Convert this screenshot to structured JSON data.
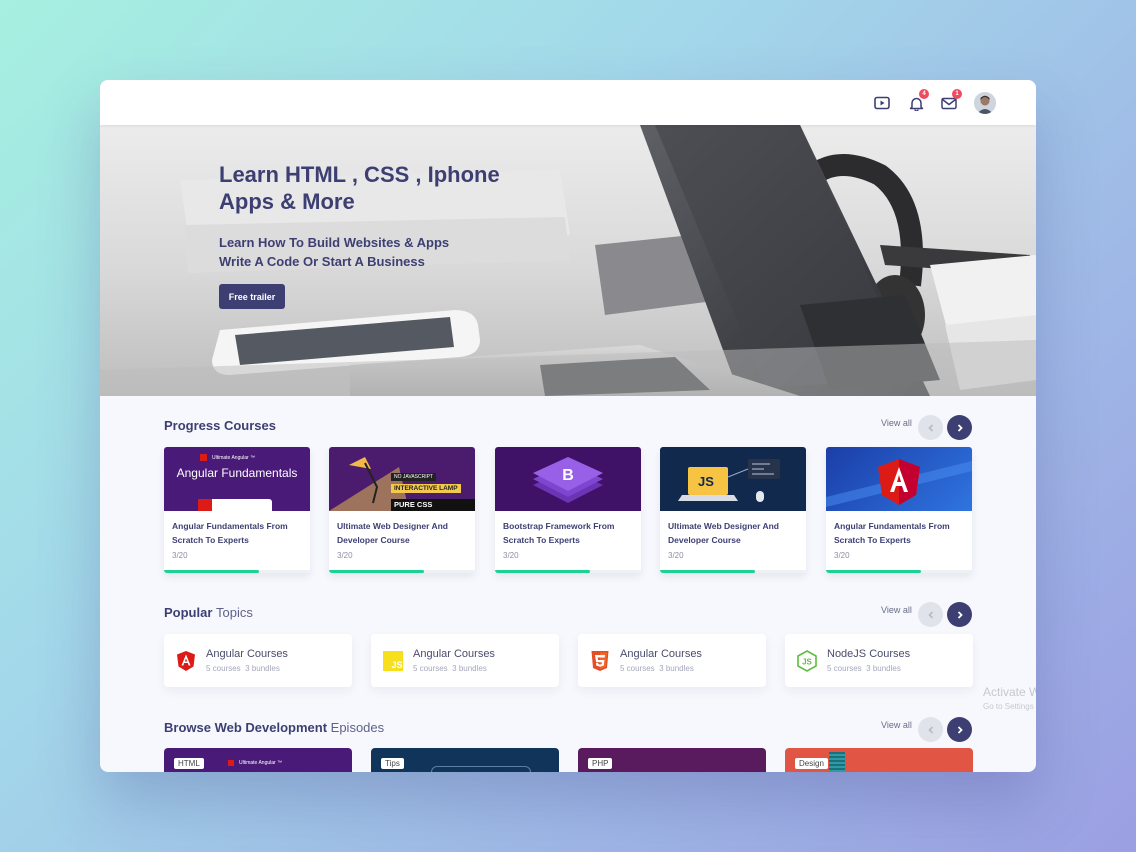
{
  "topbar": {
    "icons": [
      "video-icon",
      "bell-icon",
      "mail-icon"
    ],
    "notifications_count": "4",
    "messages_count": "1"
  },
  "hero": {
    "title": "Learn HTML , CSS , Iphone Apps & More",
    "subtitle_line1": "Learn How To Build Websites & Apps",
    "subtitle_line2": "Write A Code Or Start A Business",
    "button_label": "Free trailer"
  },
  "progress_courses": {
    "title": "Progress Courses",
    "view_all": "View all",
    "courses": [
      {
        "title": "Angular Fundamentals From Scratch To Experts",
        "progress": "3/20",
        "thumb_heading": "Angular Fundamentals",
        "thumb_caption": "Ultimate Angular ™"
      },
      {
        "title": "Ultimate Web Designer And Developer Course",
        "progress": "3/20",
        "thumb_tag1": "NO JAVASCRIPT",
        "thumb_tag2": "INTERACTIVE LAMP",
        "thumb_tag3": "PURE CSS TUTORIAL"
      },
      {
        "title": "Bootstrap Framework From Scratch To Experts",
        "progress": "3/20"
      },
      {
        "title": "Ultimate Web Designer And Developer Course",
        "progress": "3/20",
        "thumb_text": "JS"
      },
      {
        "title": "Angular Fundamentals From Scratch To Experts",
        "progress": "3/20"
      }
    ],
    "progress_fraction": 0.65
  },
  "popular_topics": {
    "title_bold": "Popular",
    "title_light": "Topics",
    "view_all": "View all",
    "topics": [
      {
        "name": "Angular Courses",
        "courses": "5 courses",
        "bundles": "3 bundles",
        "icon": "angular-icon"
      },
      {
        "name": "Angular Courses",
        "courses": "5 courses",
        "bundles": "3 bundles",
        "icon": "js-icon"
      },
      {
        "name": "Angular Courses",
        "courses": "5 courses",
        "bundles": "3 bundles",
        "icon": "html5-icon"
      },
      {
        "name": "NodeJS Courses",
        "courses": "5 courses",
        "bundles": "3 bundles",
        "icon": "nodejs-icon"
      }
    ]
  },
  "episodes": {
    "title_bold": "Browse Web Development",
    "title_light": "Episodes",
    "view_all": "View all",
    "items": [
      {
        "tag": "HTML",
        "caption": "Ultimate Angular ™"
      },
      {
        "tag": "Tips"
      },
      {
        "tag": "PHP"
      },
      {
        "tag": "Design"
      }
    ]
  },
  "watermark": {
    "line1": "Activate Windows",
    "line2": "Go to Settings to activate Windows."
  },
  "colors": {
    "primary": "#3d3f73",
    "progress": "#1dd193",
    "badge": "#ef4b5e"
  }
}
